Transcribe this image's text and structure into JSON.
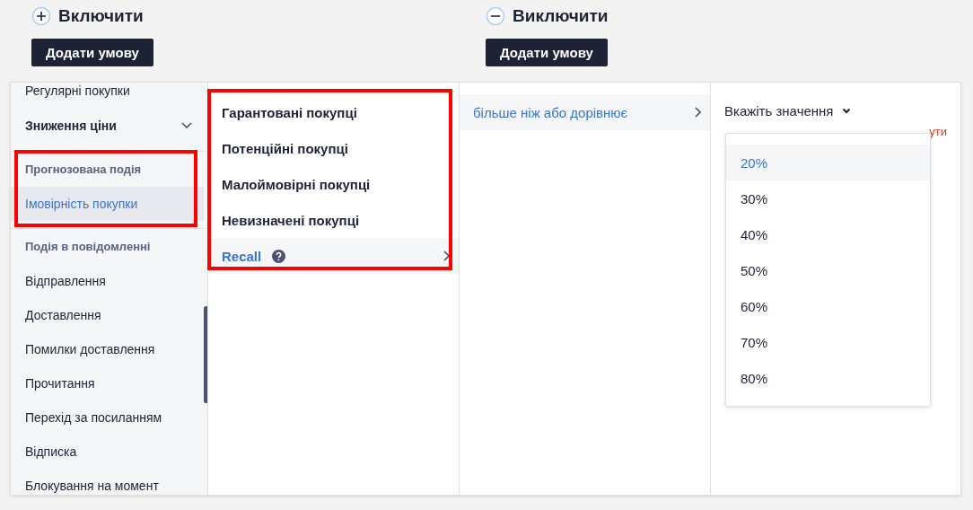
{
  "include": {
    "title": "Включити",
    "button": "Додати умову"
  },
  "exclude": {
    "title": "Виключити",
    "button": "Додати умову"
  },
  "categories": [
    {
      "kind": "item",
      "label": "Регулярні покупки",
      "selected": false
    },
    {
      "kind": "expander",
      "label": "Зниження ціни",
      "expanded": false
    },
    {
      "kind": "heading",
      "label": "Прогнозована подія"
    },
    {
      "kind": "item",
      "label": "Імовірність покупки",
      "selected": true
    },
    {
      "kind": "heading",
      "label": "Подія в повідомленні"
    },
    {
      "kind": "item",
      "label": "Відправлення",
      "selected": false
    },
    {
      "kind": "item",
      "label": "Доставлення",
      "selected": false
    },
    {
      "kind": "item",
      "label": "Помилки доставлення",
      "selected": false
    },
    {
      "kind": "item",
      "label": "Прочитання",
      "selected": false
    },
    {
      "kind": "item",
      "label": "Перехід за посиланням",
      "selected": false
    },
    {
      "kind": "item",
      "label": "Відписка",
      "selected": false
    },
    {
      "kind": "item",
      "label": "Блокування на момент",
      "selected": false
    }
  ],
  "events": [
    {
      "label": "Гарантовані покупці",
      "selected": false,
      "has_help": false,
      "has_submenu": false
    },
    {
      "label": "Потенційні покупці",
      "selected": false,
      "has_help": false,
      "has_submenu": false
    },
    {
      "label": "Малоймовірні покупці",
      "selected": false,
      "has_help": false,
      "has_submenu": false
    },
    {
      "label": "Невизначені покупці",
      "selected": false,
      "has_help": false,
      "has_submenu": false
    },
    {
      "label": "Recall",
      "selected": true,
      "has_help": true,
      "has_submenu": true
    }
  ],
  "operators": [
    {
      "label": "більше ніж або дорівнює",
      "selected": true
    }
  ],
  "value_select": {
    "placeholder": "Вкажіть значення",
    "error": "ути",
    "options": [
      {
        "label": "20%",
        "selected": true
      },
      {
        "label": "30%",
        "selected": false
      },
      {
        "label": "40%",
        "selected": false
      },
      {
        "label": "50%",
        "selected": false
      },
      {
        "label": "60%",
        "selected": false
      },
      {
        "label": "70%",
        "selected": false
      },
      {
        "label": "80%",
        "selected": false
      }
    ]
  }
}
